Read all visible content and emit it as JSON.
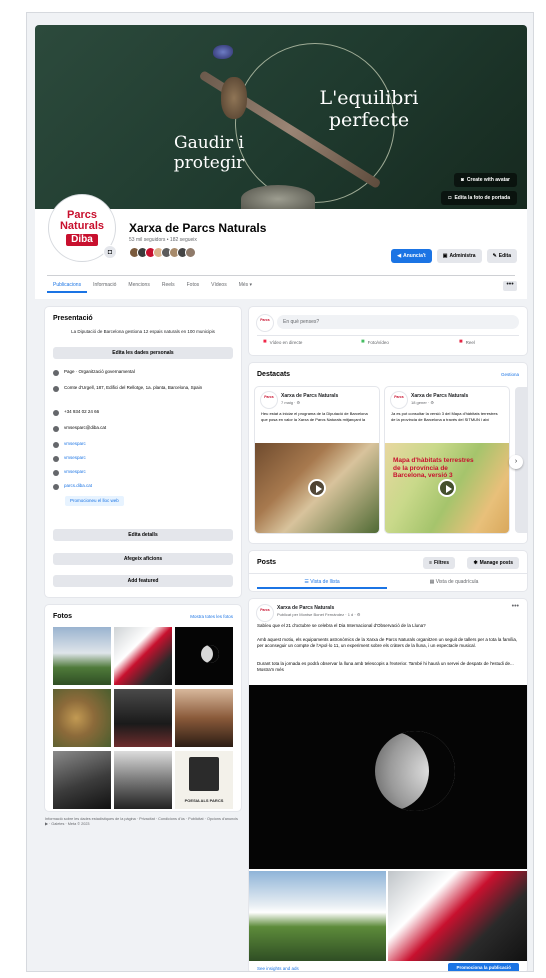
{
  "cover": {
    "headline_line1": "L'equilibri",
    "headline_line2": "perfecte",
    "tagline_line1": "Gaudir i",
    "tagline_line2": "protegir",
    "create_avatar_button": "Create with avatar",
    "edit_cover_button": "Edita la foto de portada"
  },
  "profile": {
    "logo_line1": "Parcs",
    "logo_line2": "Naturals",
    "logo_line3": "Diba",
    "name": "Xarxa de Parcs Naturals",
    "stats": "53 mil seguidors • 182 segueix",
    "buttons": {
      "promote": "Anuncia't",
      "admin": "Administra",
      "edit": "Edita"
    }
  },
  "tabs": [
    "Publicacions",
    "Informació",
    "Mencions",
    "Reels",
    "Fotos",
    "Vídeos",
    "Més ▾"
  ],
  "more_button": "•••",
  "intro": {
    "title": "Presentació",
    "bio": "La Diputació de Barcelona gestiona 12 espais naturals en 100 municipis",
    "edit_bio_button": "Edita les dades personals",
    "rows": [
      "Page · Organització governamental",
      "Comte d'Urgell, 187, Edifici del Rellotge, 1a. planta, Barcelona, Spain",
      "+34 934 02 24 66",
      "vmsesparc@diba.cat",
      "vmsesparc",
      "vmsesparc",
      "vmsesparc",
      "parcs.diba.cat"
    ],
    "promote_web": "Promocioneu el lloc web",
    "edit_details": "Edita detalls",
    "add_hobbies": "Afegeix aficions",
    "add_featured": "Add featured"
  },
  "photos": {
    "title": "Fotos",
    "see_all": "Mostra totes les fotos",
    "poster_text": "POESIA ALS PARCS"
  },
  "footer_note": "Informació sobre les dades estadístiques de la pàgina · Privacitat · Condicions d'ús · Publicitat · Opcions d'anuncis ▶ · Galetes · Meta © 2023",
  "composer": {
    "placeholder": "En què penses?",
    "live": "Vídeo en directe",
    "photo": "Foto/vídeo",
    "reel": "Reel"
  },
  "highlights": {
    "title": "Destacats",
    "manage": "Gestiona",
    "items": [
      {
        "page": "Xarxa de Parcs Naturals",
        "time": "7 maig · ⚙",
        "text": "Heu estat a iniciar el programa de la Diputació de Barcelona que posa en valor la Xarxa de Parcs Naturals mitjançant la"
      },
      {
        "page": "Xarxa de Parcs Naturals",
        "time": "18 gener · ⚙",
        "text": "Ja es pot consultar la versió 3 del Mapa d'hàbitats terrestres de la província de Barcelona a través del SITMUN i així",
        "map_title": "Mapa d'hàbitats terrestres de la província de Barcelona, versió 3"
      }
    ]
  },
  "posts": {
    "title": "Posts",
    "filters": "Filtres",
    "manage": "Manage posts",
    "list_view": "Vista de llista",
    "grid_view": "Vista de quadrícula",
    "post": {
      "page": "Xarxa de Parcs Naturals",
      "meta": "Publicat per Montse Bonet Fernández · 1 d · ⚙",
      "line1": "Sabíeu que el 21 d'octubre se celebra el Dia Internacional d'Observació de la Lluna?",
      "line2": "Amb aquest motiu, els equipaments astronòmics de la Xarxa de Parcs Naturals organitzen un seguit de tallers per a tota la família, per aconseguir un compte de l'Apol·lo 11, un experiment sobre els cràters de la lluna, i un espectacle musical.",
      "line3": "Durant tota la jornada es podrà observar la lluna amb telescopis a l'exterior. També hi haurà un servei de despatx de l'estudi de... Mostra'n més",
      "see_insights": "See insights and ads",
      "promote": "Promociona la publicació"
    }
  }
}
